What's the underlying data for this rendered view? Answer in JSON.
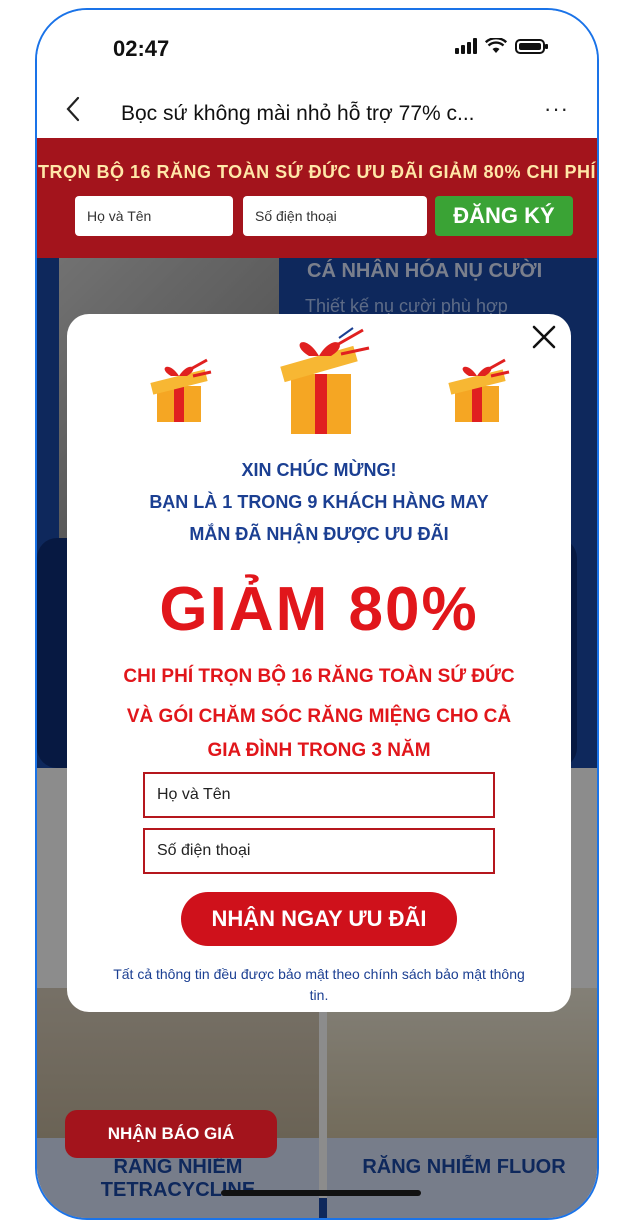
{
  "status": {
    "time": "02:47"
  },
  "nav": {
    "back_icon": "chevron-left-icon",
    "title": "Bọc sứ không mài nhỏ hỗ trợ 77% c...",
    "more_label": "···"
  },
  "promo_bar": {
    "headline": "TRỌN BỘ 16 RĂNG TOÀN SỨ ĐỨC ƯU ĐÃI GIẢM 80% CHI PHÍ",
    "name_placeholder": "Họ và Tên",
    "phone_placeholder": "Số điện thoại",
    "register_label": "ĐĂNG KÝ"
  },
  "background": {
    "heading": "CÁ NHÂN HÓA NỤ CƯỜI",
    "subtext": "Thiết kế nụ cười phù hợp",
    "teeth_left_label": "RĂNG NHIỄM TETRACYCLINE",
    "teeth_right_label": "RĂNG NHIỄM FLUOR",
    "quote_button": "NHẬN BÁO GIÁ"
  },
  "popup": {
    "close_label": "✕",
    "congrats": "XIN CHÚC MỪNG!",
    "lucky_line1": "BẠN LÀ 1 TRONG 9 KHÁCH HÀNG MAY",
    "lucky_line2": "MẮN ĐÃ NHẬN ĐƯỢC ƯU ĐÃI",
    "discount": "GIẢM 80%",
    "desc_line1": "CHI PHÍ TRỌN BỘ 16 RĂNG TOÀN SỨ ĐỨC",
    "desc_line2": "VÀ GÓI CHĂM SÓC RĂNG MIỆNG CHO CẢ",
    "desc_line3": "GIA ĐÌNH TRONG 3 NĂM",
    "name_placeholder": "Họ và Tên",
    "phone_placeholder": "Số điện thoại",
    "claim_button": "NHẬN NGAY ƯU ĐÃI",
    "privacy_text": "Tất cả thông tin đều được bảo mật theo chính sách bảo mật thông tin."
  },
  "colors": {
    "accent_red": "#cf111b",
    "promo_red": "#a3141c",
    "navy": "#1b3f92",
    "register_green": "#3aa335"
  }
}
